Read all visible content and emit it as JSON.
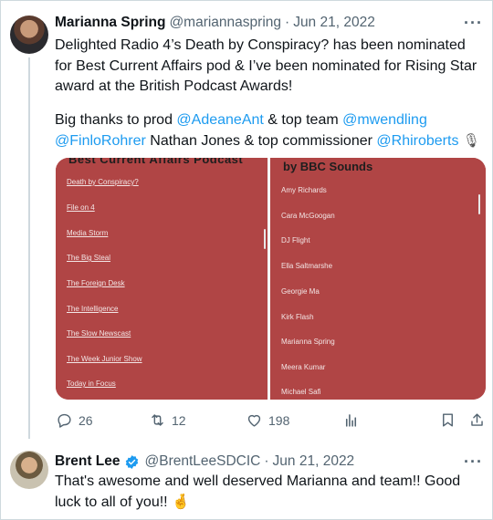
{
  "tweet1": {
    "name": "Marianna Spring",
    "handle": "@mariannaspring",
    "sep": "·",
    "date": "Jun 21, 2022",
    "more": "···",
    "lines": [
      "Delighted Radio 4’s Death by Conspiracy? has been nominated",
      "for Best Current Affairs pod & I’ve been nominated for Rising Star",
      "award at the British Podcast Awards!"
    ],
    "thanks_prefix": "Big thanks to prod ",
    "mention1": "@AdeaneAnt",
    "thanks_mid": " & top team ",
    "mention2": "@mwendling",
    "mention3": "@FinloRohrer",
    "thanks_mid2": " Nathan Jones & top commissioner ",
    "mention4": "@Rhiroberts",
    "emoji": "🎙",
    "media": {
      "left_heading": "Best Current Affairs Podcast",
      "left_items": [
        "Death by Conspiracy?",
        "File on 4",
        "Media Storm",
        "The Big Steal",
        "The Foreign Desk",
        "The Intelligence",
        "The Slow Newscast",
        "The Week Junior Show",
        "Today in Focus"
      ],
      "right_heading": "by BBC Sounds",
      "right_items": [
        "Amy Richards",
        "Cara McGoogan",
        "DJ Flight",
        "Ella Saltmarshe",
        "Georgie Ma",
        "Kirk Flash",
        "Marianna Spring",
        "Meera Kumar",
        "Michael Safi"
      ]
    },
    "actions": {
      "replies": "26",
      "retweets": "12",
      "likes": "198"
    }
  },
  "tweet2": {
    "name": "Brent Lee",
    "handle": "@BrentLeeSDCIC",
    "sep": "·",
    "date": "Jun 21, 2022",
    "more": "···",
    "lines": [
      "That's awesome and well deserved Marianna and team!! Good",
      "luck to all of you!! 🤞"
    ]
  },
  "colors": {
    "link": "#1d9bf0",
    "muted": "#536471",
    "media_bg": "#b04545",
    "verified": "#1d9bf0"
  }
}
